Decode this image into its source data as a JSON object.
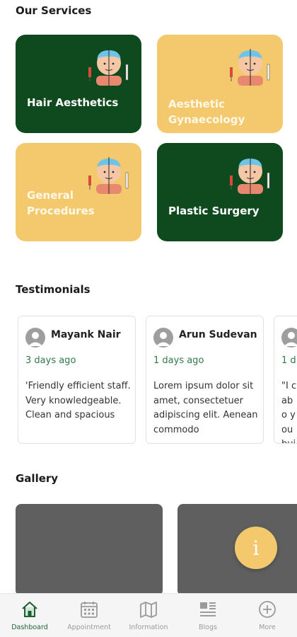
{
  "services": {
    "title": "Our Services",
    "items": [
      {
        "label": "Hair Aesthetics",
        "icon": "face-treatment-icon"
      },
      {
        "label": "Aesthetic Gynaecology",
        "icon": "face-treatment-icon"
      },
      {
        "label": "General Procedures",
        "icon": "face-treatment-icon"
      },
      {
        "label": "Plastic Surgery",
        "icon": "face-treatment-icon"
      }
    ]
  },
  "testimonials": {
    "title": "Testimonials",
    "items": [
      {
        "name": "Mayank Nair",
        "date": "3 days ago",
        "text": "'Friendly efficient staff. Very knowledgeable. Clean and spacious"
      },
      {
        "name": "Arun Sudevan",
        "date": "1 days ago",
        "text": "Lorem ipsum dolor sit amet, consectetuer adipiscing elit. Aenean commodo"
      },
      {
        "name": "",
        "date": "1 d",
        "text": "\"I c abo you buil"
      }
    ]
  },
  "gallery": {
    "title": "Gallery",
    "fab_label": "i"
  },
  "nav": {
    "items": [
      {
        "label": "Dashboard",
        "icon": "home-icon",
        "active": true
      },
      {
        "label": "Appointment",
        "icon": "calendar-icon",
        "active": false
      },
      {
        "label": "Information",
        "icon": "map-icon",
        "active": false
      },
      {
        "label": "Blogs",
        "icon": "news-icon",
        "active": false
      },
      {
        "label": "More",
        "icon": "plus-circle-icon",
        "active": false
      }
    ]
  },
  "colors": {
    "dark_green": "#0f4a1f",
    "gold": "#f4c96e",
    "date_green": "#2f7a4a",
    "gallery_gray": "#5f5f5f"
  }
}
